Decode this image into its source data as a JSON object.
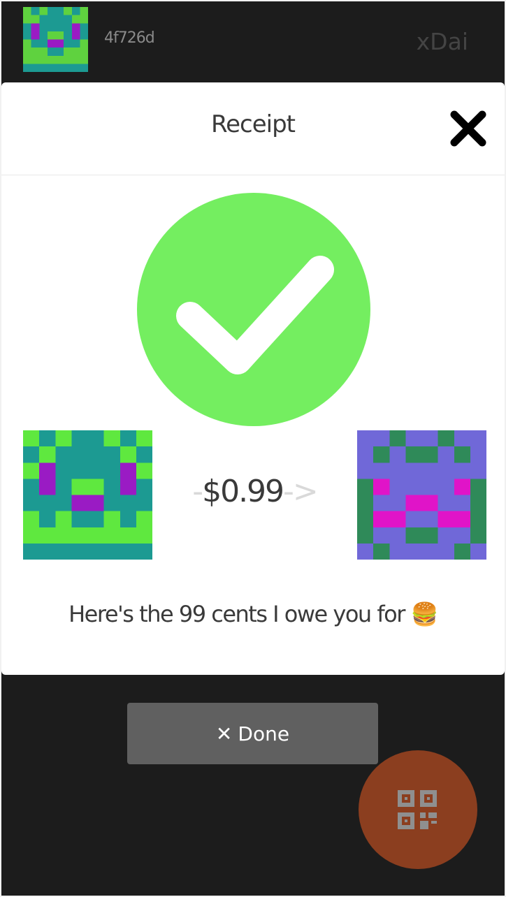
{
  "topbar": {
    "address": "4f726d",
    "network": "xDai"
  },
  "modal": {
    "title": "Receipt",
    "amount_prefix": "-",
    "amount": "$0.99",
    "amount_suffix": "->",
    "message": "Here's the 99 cents I owe you for 🍔"
  },
  "actions": {
    "done_label": "Done"
  },
  "icons": {
    "close": "close-icon",
    "check": "checkmark-icon",
    "done": "x-icon",
    "qr": "qr-code-icon"
  },
  "colors": {
    "check_green": "#74ee60",
    "fab": "#8b3e1f",
    "done_button": "#606060"
  }
}
